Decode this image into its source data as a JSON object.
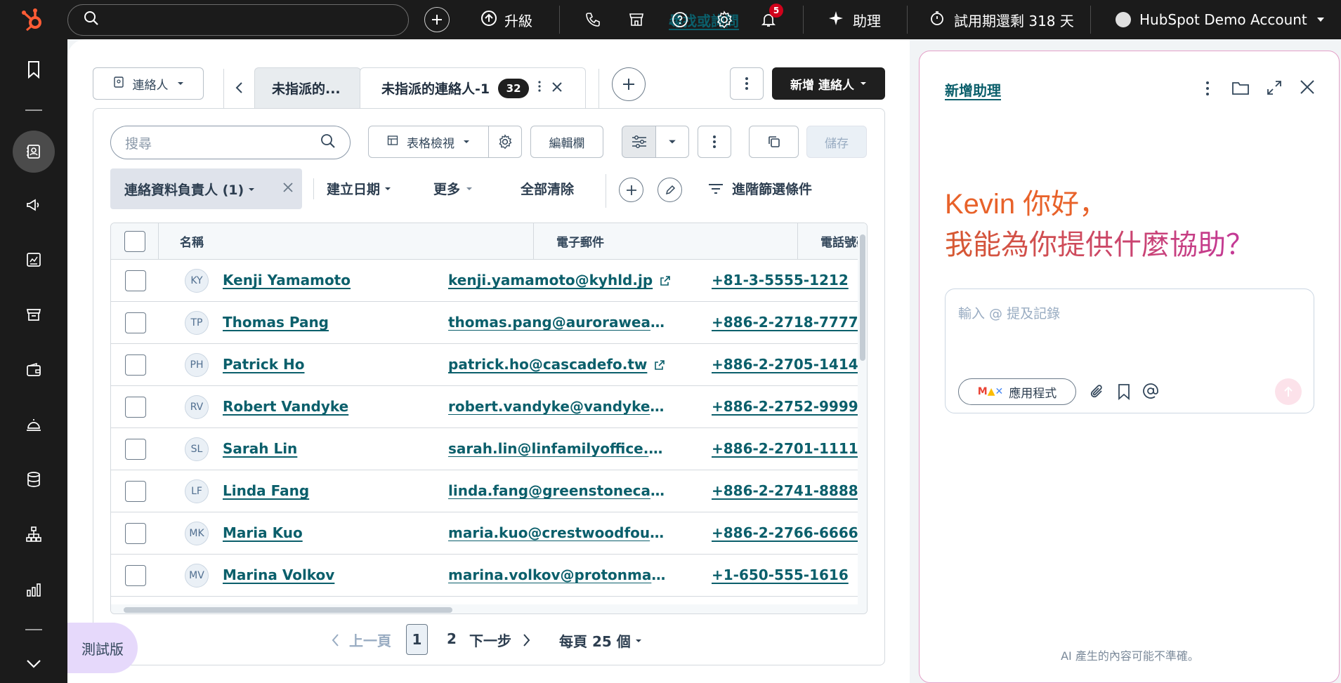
{
  "topbar": {
    "search_placeholder": "尋找或詢問",
    "upgrade_label": "升級",
    "notification_count": "5",
    "assistant_label": "助理",
    "trial_label": "試用期還剩 318 天",
    "account_name": "HubSpot Demo Account"
  },
  "sidebar": {
    "icons": [
      "bookmark-icon",
      "contacts-icon",
      "megaphone-icon",
      "reports-icon",
      "store-icon",
      "wallet-icon",
      "bell-service-icon",
      "database-icon",
      "org-chart-icon",
      "bar-chart-icon",
      "chevron-down-icon"
    ]
  },
  "views": {
    "object_selector": "連絡人",
    "tab_inactive": "未指派的...",
    "tab_active": "未指派的連絡人-1",
    "tab_active_count": "32",
    "add_contact_label": "新增 連絡人"
  },
  "toolbar": {
    "search_placeholder": "搜尋",
    "table_view_label": "表格檢視",
    "edit_columns_label": "編輯欄",
    "save_label": "儲存"
  },
  "filters": {
    "owner_filter": "連絡資料負責人 (1)",
    "created_date": "建立日期",
    "more": "更多",
    "clear_all": "全部清除",
    "advanced": "進階篩選條件"
  },
  "table": {
    "columns": [
      "名稱",
      "電子郵件",
      "電話號碼"
    ],
    "rows": [
      {
        "initials": "KY",
        "name": "Kenji Yamamoto",
        "email": "kenji.yamamoto@kyhld.jp",
        "phone": "+81-3-5555-1212",
        "external": true
      },
      {
        "initials": "TP",
        "name": "Thomas Pang",
        "email": "thomas.pang@aurorawealth...",
        "phone": "+886-2-2718-7777",
        "external": false
      },
      {
        "initials": "PH",
        "name": "Patrick Ho",
        "email": "patrick.ho@cascadefo.tw",
        "phone": "+886-2-2705-1414",
        "external": true
      },
      {
        "initials": "RV",
        "name": "Robert Vandyke",
        "email": "robert.vandyke@vandykeh...",
        "phone": "+886-2-2752-9999",
        "external": false
      },
      {
        "initials": "SL",
        "name": "Sarah Lin",
        "email": "sarah.lin@linfamilyoffice.tw...",
        "phone": "+886-2-2701-1111",
        "external": false
      },
      {
        "initials": "LF",
        "name": "Linda Fang",
        "email": "linda.fang@greenstonecap.t...",
        "phone": "+886-2-2741-8888",
        "external": false
      },
      {
        "initials": "MK",
        "name": "Maria Kuo",
        "email": "maria.kuo@crestwoodfoun...",
        "phone": "+886-2-2766-6666",
        "external": false
      },
      {
        "initials": "MV",
        "name": "Marina Volkov",
        "email": "marina.volkov@protonmail....",
        "phone": "+1-650-555-1616",
        "external": false
      }
    ]
  },
  "pagination": {
    "prev": "上一頁",
    "page1": "1",
    "page2": "2",
    "next": "下一步",
    "per_page": "每頁 25 個"
  },
  "assistant_panel": {
    "title": "新增助理",
    "greeting_line1": "Kevin 你好，",
    "greeting_line2": "我能為你提供什麼協助？",
    "input_placeholder": "輸入 @ 提及記錄",
    "apps_label": "應用程式",
    "disclaimer": "AI 產生的內容可能不準確。"
  },
  "beta_label": "測試版",
  "colors": {
    "accent_orange": "#ff5c35",
    "link_teal": "#0b5f6b",
    "greeting_orange": "#e8622a",
    "greeting_pink": "#c2379b"
  }
}
